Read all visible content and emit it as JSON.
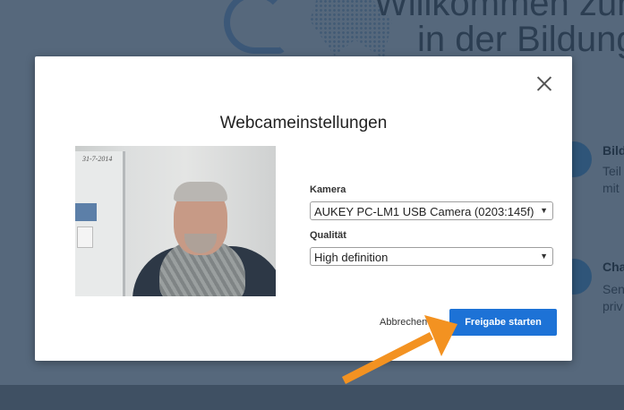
{
  "background": {
    "heading_line1": "Willkommen zur",
    "heading_line2": "in der Bildungs",
    "feature1_title": "Bild",
    "feature1_line1": "Teil",
    "feature1_line2": "mit",
    "feature2_title": "Cha",
    "feature2_line1": "Sen",
    "feature2_line2": "priv"
  },
  "modal": {
    "title": "Webcameinstellungen",
    "close_icon": "close-icon",
    "preview_writing": "31-7-2014",
    "camera": {
      "label": "Kamera",
      "value": "AUKEY PC-LM1 USB Camera (0203:145f)"
    },
    "quality": {
      "label": "Qualität",
      "value": "High definition"
    },
    "cancel_label": "Abbrechen",
    "start_label": "Freigabe starten"
  },
  "colors": {
    "primary_button": "#1d72d6",
    "arrow": "#f39221",
    "overlay": "#56687c"
  }
}
